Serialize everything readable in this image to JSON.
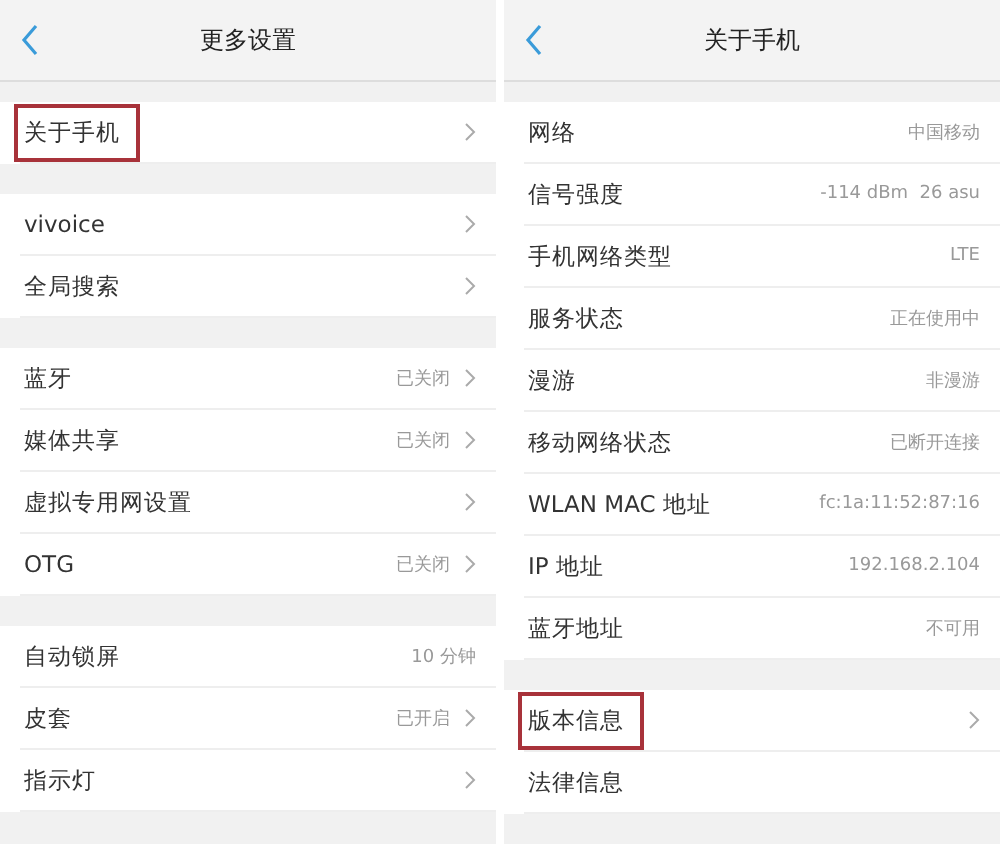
{
  "panels": [
    {
      "title": "更多设置",
      "sections": [
        [
          {
            "label": "关于手机",
            "chevron": true,
            "highlighted": true
          }
        ],
        [
          {
            "label": "vivoice",
            "chevron": true,
            "highlighted": false
          },
          {
            "label": "全局搜索",
            "chevron": true,
            "highlighted": false
          }
        ],
        [
          {
            "label": "蓝牙",
            "value": "已关闭",
            "chevron": true,
            "highlighted": false
          },
          {
            "label": "媒体共享",
            "value": "已关闭",
            "chevron": true,
            "highlighted": false
          },
          {
            "label": "虚拟专用网设置",
            "chevron": true,
            "highlighted": false
          },
          {
            "label": "OTG",
            "value": "已关闭",
            "chevron": true,
            "highlighted": false
          }
        ],
        [
          {
            "label": "自动锁屏",
            "value": "10 分钟",
            "chevron": false,
            "highlighted": false
          },
          {
            "label": "皮套",
            "value": "已开启",
            "chevron": true,
            "highlighted": false
          },
          {
            "label": "指示灯",
            "chevron": true,
            "highlighted": false
          }
        ]
      ]
    },
    {
      "title": "关于手机",
      "sections": [
        [
          {
            "label": "网络",
            "value": "中国移动",
            "chevron": false,
            "highlighted": false
          },
          {
            "label": "信号强度",
            "value": "-114 dBm  26 asu",
            "chevron": false,
            "highlighted": false
          },
          {
            "label": "手机网络类型",
            "value": "LTE",
            "chevron": false,
            "highlighted": false
          },
          {
            "label": "服务状态",
            "value": "正在使用中",
            "chevron": false,
            "highlighted": false
          },
          {
            "label": "漫游",
            "value": "非漫游",
            "chevron": false,
            "highlighted": false
          },
          {
            "label": "移动网络状态",
            "value": "已断开连接",
            "chevron": false,
            "highlighted": false
          },
          {
            "label": "WLAN MAC 地址",
            "value": "fc:1a:11:52:87:16",
            "chevron": false,
            "highlighted": false
          },
          {
            "label": "IP 地址",
            "value": "192.168.2.104",
            "chevron": false,
            "highlighted": false
          },
          {
            "label": "蓝牙地址",
            "value": "不可用",
            "chevron": false,
            "highlighted": false
          }
        ],
        [
          {
            "label": "版本信息",
            "chevron": true,
            "highlighted": true
          },
          {
            "label": "法律信息",
            "chevron": false,
            "highlighted": false
          }
        ]
      ]
    }
  ]
}
